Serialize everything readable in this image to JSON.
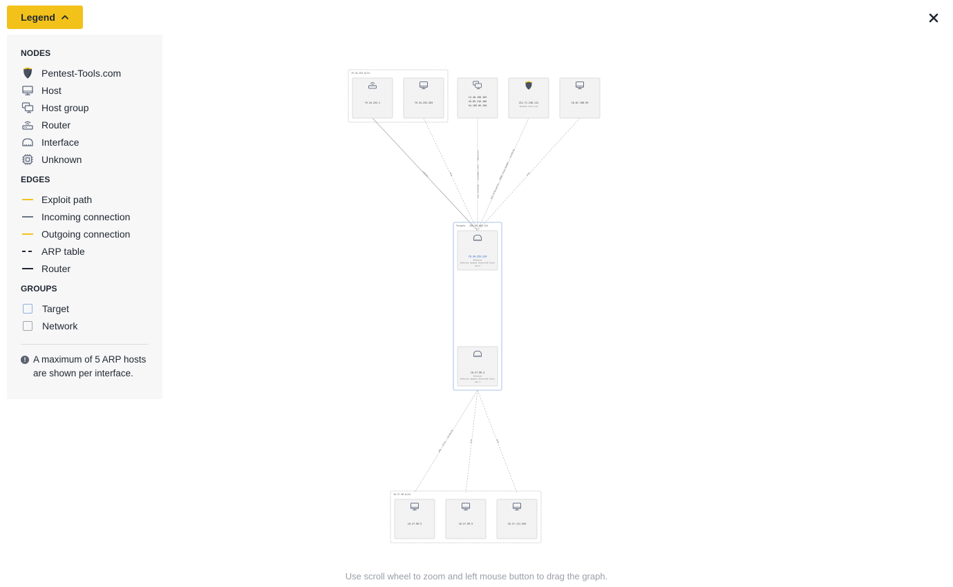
{
  "legend_button": {
    "label": "Legend",
    "icon": "chevron-up-icon"
  },
  "close_button": {
    "icon": "close-icon"
  },
  "legend": {
    "nodes_title": "NODES",
    "nodes": [
      {
        "label": "Pentest-Tools.com",
        "icon": "pentest-tools-shield-icon"
      },
      {
        "label": "Host",
        "icon": "host-monitor-icon"
      },
      {
        "label": "Host group",
        "icon": "host-group-icon"
      },
      {
        "label": "Router",
        "icon": "router-icon"
      },
      {
        "label": "Interface",
        "icon": "interface-icon"
      },
      {
        "label": "Unknown",
        "icon": "chip-icon"
      }
    ],
    "edges_title": "EDGES",
    "edges": [
      {
        "label": "Exploit path",
        "color": "#f2c21a",
        "style": "solid"
      },
      {
        "label": "Incoming connection",
        "color": "#6b7480",
        "style": "solid"
      },
      {
        "label": "Outgoing connection",
        "color": "#f2c21a",
        "style": "solid"
      },
      {
        "label": "ARP table",
        "color": "#1f2630",
        "style": "dashed"
      },
      {
        "label": "Router",
        "color": "#1f2630",
        "style": "solid"
      }
    ],
    "groups_title": "GROUPS",
    "groups": [
      {
        "label": "Target",
        "color": "#8fb0e0"
      },
      {
        "label": "Network",
        "color": "#a0a4aa"
      }
    ],
    "note": "A maximum of 5 ARP hosts are shown per interface."
  },
  "graph": {
    "groups": [
      {
        "id": "g-top",
        "type": "network",
        "label": "79.34.253.0/24"
      },
      {
        "id": "g-target",
        "type": "target",
        "label": "Targets - 209.59.200.124"
      },
      {
        "id": "g-bottom",
        "type": "network",
        "label": "10.27.96.0/24"
      }
    ],
    "nodes": [
      {
        "id": "n-router",
        "type": "router",
        "lines": [
          "79.34.253.1"
        ],
        "group": "g-top"
      },
      {
        "id": "n-host-a",
        "type": "host",
        "lines": [
          "79.34.253.203"
        ],
        "group": "g-top"
      },
      {
        "id": "n-hostgroup",
        "type": "hostgroup",
        "lines": [
          "13.48.198.169",
          "49.89.216.106",
          "54.189.96.190"
        ]
      },
      {
        "id": "n-ptt",
        "type": "pentest",
        "lines": [
          "212.71.238.112"
        ],
        "sub": "Pentest-Tools.com"
      },
      {
        "id": "n-host-b",
        "type": "host",
        "lines": [
          "16.87.198.99"
        ]
      },
      {
        "id": "n-if1",
        "type": "interface",
        "lines": [
          "79.34.253.214"
        ],
        "highlight": true,
        "sub": [
          "Ethernet",
          "Ethernet adapter Ethernet0 Intel",
          "eth 0"
        ],
        "group": "g-target"
      },
      {
        "id": "n-if2",
        "type": "interface",
        "lines": [
          "10.27.96.3"
        ],
        "sub": [
          "Ethernet",
          "Ethernet adapter Ethernet0 Intel",
          "eth 1"
        ],
        "group": "g-target"
      },
      {
        "id": "n-host-c",
        "type": "host",
        "lines": [
          "10.27.96.5"
        ],
        "group": "g-bottom"
      },
      {
        "id": "n-host-d",
        "type": "host",
        "lines": [
          "10.27.96.5"
        ],
        "group": "g-bottom"
      },
      {
        "id": "n-host-e",
        "type": "host",
        "lines": [
          "10.27.111.203"
        ],
        "group": "g-bottom"
      }
    ],
    "edges": [
      {
        "from": "n-router",
        "to": "n-if1",
        "kind": "router",
        "label": "router"
      },
      {
        "from": "n-host-a",
        "to": "n-if1",
        "kind": "arp",
        "label": "arp"
      },
      {
        "from": "n-hostgroup",
        "to": "n-if1",
        "kind": "incoming",
        "label": "hostname - user-computer - windows arp"
      },
      {
        "from": "n-ptt",
        "to": "n-if1",
        "kind": "incoming",
        "label": "443 http-proxy - 8080 http-header - incoming"
      },
      {
        "from": "n-host-b",
        "to": "n-if1",
        "kind": "arp",
        "label": "arp"
      },
      {
        "from": "n-if2",
        "to": "n-host-c",
        "kind": "incoming",
        "label": "smb - http - incoming"
      },
      {
        "from": "n-if2",
        "to": "n-host-d",
        "kind": "arp",
        "label": "arp"
      },
      {
        "from": "n-if2",
        "to": "n-host-e",
        "kind": "arp",
        "label": "arp"
      }
    ]
  },
  "hint": "Use scroll wheel to zoom and left mouse button to drag the graph."
}
